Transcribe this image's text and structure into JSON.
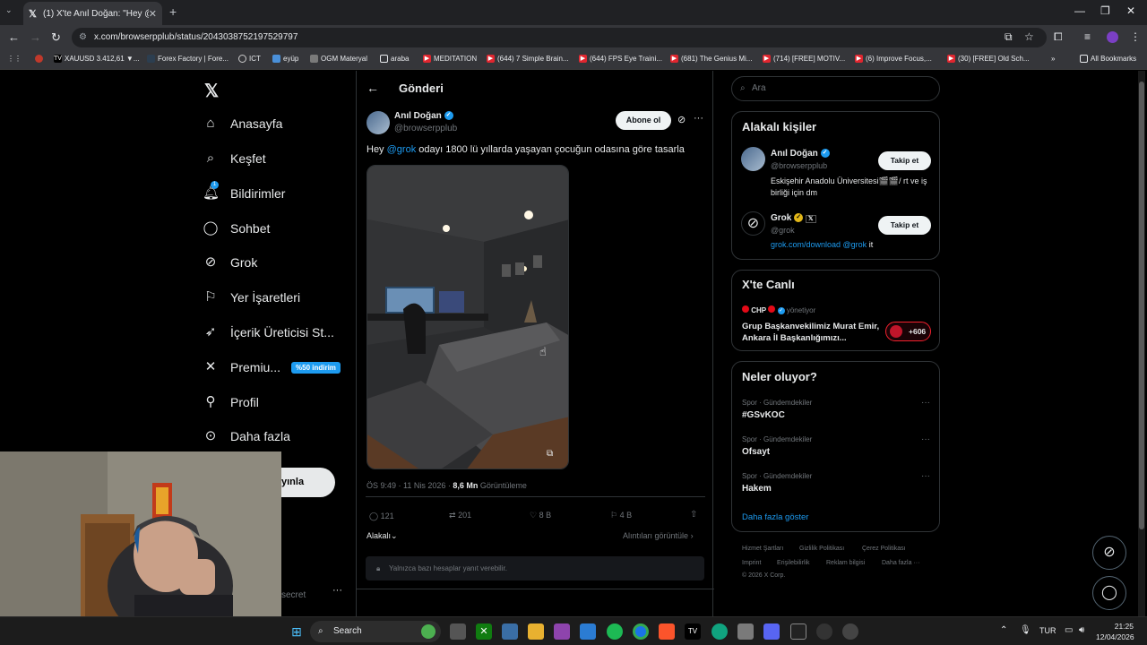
{
  "browser": {
    "tab_title": "(1) X'te Anıl Doğan: \"Hey @gro",
    "tab_close": "✕",
    "new_tab": "+",
    "url": "x.com/browserpplub/status/2043038752197529797",
    "bookmarks": [
      {
        "label": "XAUUSD 3.412,61 ▼..."
      },
      {
        "label": "Forex Factory | Fore..."
      },
      {
        "label": "ICT"
      },
      {
        "label": "eyüp"
      },
      {
        "label": "OGM Materyal"
      },
      {
        "label": "araba"
      },
      {
        "label": "MEDITATION"
      },
      {
        "label": "(644) 7 Simple Brain..."
      },
      {
        "label": "(644) FPS Eye Traini..."
      },
      {
        "label": "(681) The Genius Mi..."
      },
      {
        "label": "(714) [FREE] MOTIV..."
      },
      {
        "label": "(6) Improve Focus,..."
      },
      {
        "label": "(30) [FREE] Old Sch..."
      }
    ],
    "all_bookmarks": "All Bookmarks"
  },
  "nav": {
    "items": [
      {
        "label": "Anasayfa"
      },
      {
        "label": "Keşfet"
      },
      {
        "label": "Bildirimler",
        "badge": "1"
      },
      {
        "label": "Sohbet"
      },
      {
        "label": "Grok"
      },
      {
        "label": "Yer İşaretleri"
      },
      {
        "label": "İçerik Üreticisi St..."
      },
      {
        "label": "Premiu...",
        "tag": "%50 indirim"
      },
      {
        "label": "Profil"
      },
      {
        "label": "Daha fazla"
      }
    ],
    "post_button": "yınla",
    "account_fragment": "secret",
    "account_more": "···"
  },
  "post": {
    "header_title": "Gönderi",
    "author_name": "Anıl Doğan",
    "author_handle": "@browserpplub",
    "subscribe": "Abone ol",
    "more": "···",
    "text_prefix": "Hey ",
    "mention": "@grok",
    "text_suffix": "  odayı 1800 lü yıllarda yaşayan çocuğun odasına göre tasarla",
    "time": "ÖS 9:49 · 11 Nis 2026 · ",
    "views_value": "8,6 Mn",
    "views_label": " Görüntüleme",
    "replies": "121",
    "reposts": "201",
    "likes": "8 B",
    "bookmarks": "4 B",
    "sort": "Alakalı",
    "quotes_link": "Alıntıları görüntüle",
    "reply_notice": "Yalnızca bazı hesaplar yanıt verebilir."
  },
  "right": {
    "search_placeholder": "Ara",
    "relevant_title": "Alakalı kişiler",
    "people": [
      {
        "name": "Anıl Doğan",
        "handle": "@browserpplub",
        "bio": "Eskişehir Anadolu Üniversitesi🎬🎬/ rt ve iş birliği için dm",
        "follow": "Takip et"
      },
      {
        "name": "Grok",
        "handle": "@grok",
        "bio_link": "grok.com/download @grok",
        "bio_tail": " it",
        "follow": "Takip et"
      }
    ],
    "live_title": "X'te Canlı",
    "live_host": "CHP",
    "live_role": "yönetiyor",
    "live_text": "Grup Başkanvekilimiz Murat Emir, Ankara İl Başkanlığımızı...",
    "live_count": "+606",
    "trends_title": "Neler oluyor?",
    "trends": [
      {
        "meta": "Spor · Gündemdekiler",
        "name": "#GSvKOC"
      },
      {
        "meta": "Spor · Gündemdekiler",
        "name": "Ofsayt"
      },
      {
        "meta": "Spor · Gündemdekiler",
        "name": "Hakem"
      }
    ],
    "show_more": "Daha fazla göster",
    "footer": [
      "Hizmet Şartları",
      "Gizlilik Politikası",
      "Çerez Politikası",
      "Imprint",
      "Erişilebilirlik",
      "Reklam bilgisi",
      "Daha fazla ···",
      "© 2026 X Corp."
    ]
  },
  "taskbar": {
    "search": "Search",
    "lang": "TUR",
    "time": "21:25",
    "date": "12/04/2026"
  }
}
